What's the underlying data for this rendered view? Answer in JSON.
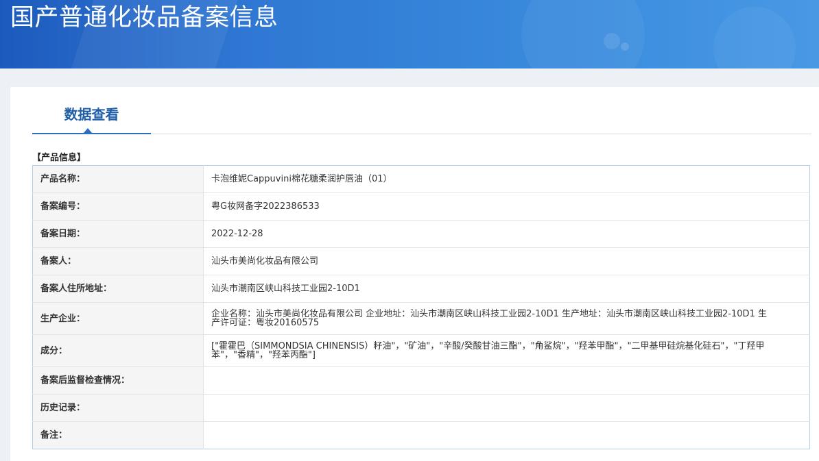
{
  "header": {
    "title": "国产普通化妆品备案信息"
  },
  "tabs": [
    {
      "label": "数据查看",
      "active": true
    }
  ],
  "section": {
    "title": "【产品信息】"
  },
  "product_info": [
    {
      "label": "产品名称：",
      "value": "卡泡维妮Cappuvini棉花糖柔润护唇油（01）"
    },
    {
      "label": "备案编号：",
      "value": "粤G妆网备字2022386533"
    },
    {
      "label": "备案日期：",
      "value": "2022-12-28"
    },
    {
      "label": "备案人：",
      "value": "汕头市美尚化妆品有限公司"
    },
    {
      "label": "备案人住所地址：",
      "value": "汕头市潮南区峡山科技工业园2-10D1"
    },
    {
      "label": "生产企业：",
      "value": "企业名称：汕头市美尚化妆品有限公司 企业地址：汕头市潮南区峡山科技工业园2-10D1 生产地址：汕头市潮南区峡山科技工业园2-10D1 生产许可证：粤妆20160575"
    },
    {
      "label": "成分：",
      "value": "[\"霍霍巴（SIMMONDSIA CHINENSIS）籽油\"，\"矿油\"，\"辛酸/癸酸甘油三酯\"，\"角鲨烷\"，\"羟苯甲酯\"，\"二甲基甲硅烷基化硅石\"，\"丁羟甲苯\"，\"香精\"，\"羟苯丙酯\"]"
    },
    {
      "label": "备案后监督检查情况：",
      "value": ""
    },
    {
      "label": "历史记录：",
      "value": ""
    },
    {
      "label": "备注：",
      "value": ""
    }
  ],
  "colors": {
    "banner_start": "#1c5bbd",
    "banner_end": "#4898e4",
    "accent": "#2a6fc0",
    "tab_text": "#1f5ea8",
    "table_border": "#b3cde8",
    "label_background": "#f5f5f5",
    "page_background": "#edf1f5"
  }
}
